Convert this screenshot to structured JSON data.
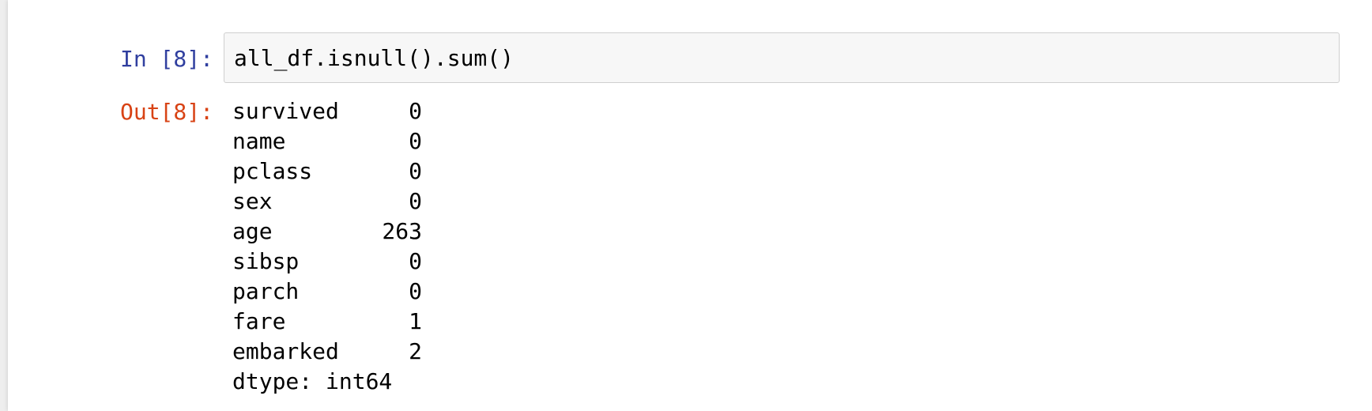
{
  "cell": {
    "in_prompt": "In [8]:",
    "code": "all_df.isnull().sum()",
    "out_prompt": "Out[8]:",
    "output": {
      "rows": [
        {
          "name": "survived",
          "value": "0"
        },
        {
          "name": "name",
          "value": "0"
        },
        {
          "name": "pclass",
          "value": "0"
        },
        {
          "name": "sex",
          "value": "0"
        },
        {
          "name": "age",
          "value": "263"
        },
        {
          "name": "sibsp",
          "value": "0"
        },
        {
          "name": "parch",
          "value": "0"
        },
        {
          "name": "fare",
          "value": "1"
        },
        {
          "name": "embarked",
          "value": "2"
        }
      ],
      "dtype": "dtype: int64"
    }
  },
  "colors": {
    "in_prompt": "#303f9f",
    "out_prompt": "#d84315",
    "input_background": "#f7f7f7",
    "input_border": "#cfcfcf"
  }
}
